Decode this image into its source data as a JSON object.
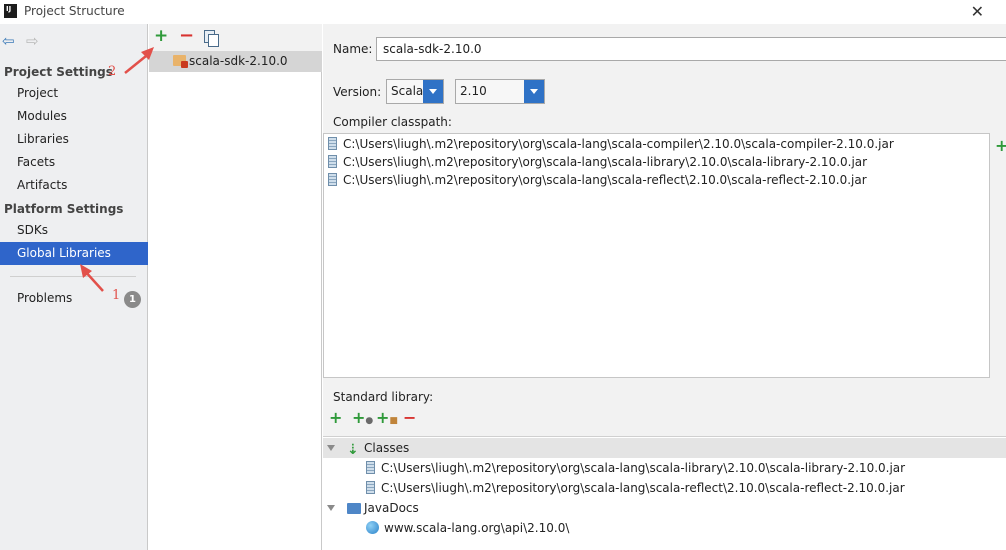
{
  "window": {
    "title": "Project Structure",
    "close_glyph": "✕"
  },
  "nav": {
    "back_icon": "back-arrow-icon",
    "forward_icon": "forward-arrow-icon",
    "project_settings_header": "Project Settings",
    "project_settings_items": [
      "Project",
      "Modules",
      "Libraries",
      "Facets",
      "Artifacts"
    ],
    "platform_settings_header": "Platform Settings",
    "platform_settings_items": [
      "SDKs",
      "Global Libraries"
    ],
    "selected_item": "Global Libraries",
    "problems_label": "Problems",
    "problems_count": "1"
  },
  "annotations": {
    "marker_1": "1",
    "marker_2": "2",
    "color": "#e2504a"
  },
  "middle": {
    "toolbar": {
      "add_glyph": "+",
      "remove_glyph": "−"
    },
    "libraries": [
      {
        "label": "scala-sdk-2.10.0",
        "selected": true
      }
    ]
  },
  "detail": {
    "name_label": "Name:",
    "name_value": "scala-sdk-2.10.0",
    "version_label": "Version:",
    "version_kind": "Scala",
    "version_number": "2.10",
    "compiler_classpath_label": "Compiler classpath:",
    "compiler_classpath": [
      "C:\\Users\\liugh\\.m2\\repository\\org\\scala-lang\\scala-compiler\\2.10.0\\scala-compiler-2.10.0.jar",
      "C:\\Users\\liugh\\.m2\\repository\\org\\scala-lang\\scala-library\\2.10.0\\scala-library-2.10.0.jar",
      "C:\\Users\\liugh\\.m2\\repository\\org\\scala-lang\\scala-reflect\\2.10.0\\scala-reflect-2.10.0.jar"
    ],
    "side_add_glyph": "+",
    "standard_library_label": "Standard library:",
    "std_toolbar": {
      "add_glyph": "+",
      "remove_glyph": "−"
    },
    "std_tree": {
      "classes_label": "Classes",
      "classes": [
        "C:\\Users\\liugh\\.m2\\repository\\org\\scala-lang\\scala-library\\2.10.0\\scala-library-2.10.0.jar",
        "C:\\Users\\liugh\\.m2\\repository\\org\\scala-lang\\scala-reflect\\2.10.0\\scala-reflect-2.10.0.jar"
      ],
      "javadocs_label": "JavaDocs",
      "javadocs": [
        "www.scala-lang.org\\api\\2.10.0\\"
      ]
    }
  },
  "colors": {
    "selection_blue": "#2f65ca",
    "add_green": "#2f9a3a",
    "remove_red": "#d8322f",
    "dropdown_blue": "#2f72c6"
  }
}
